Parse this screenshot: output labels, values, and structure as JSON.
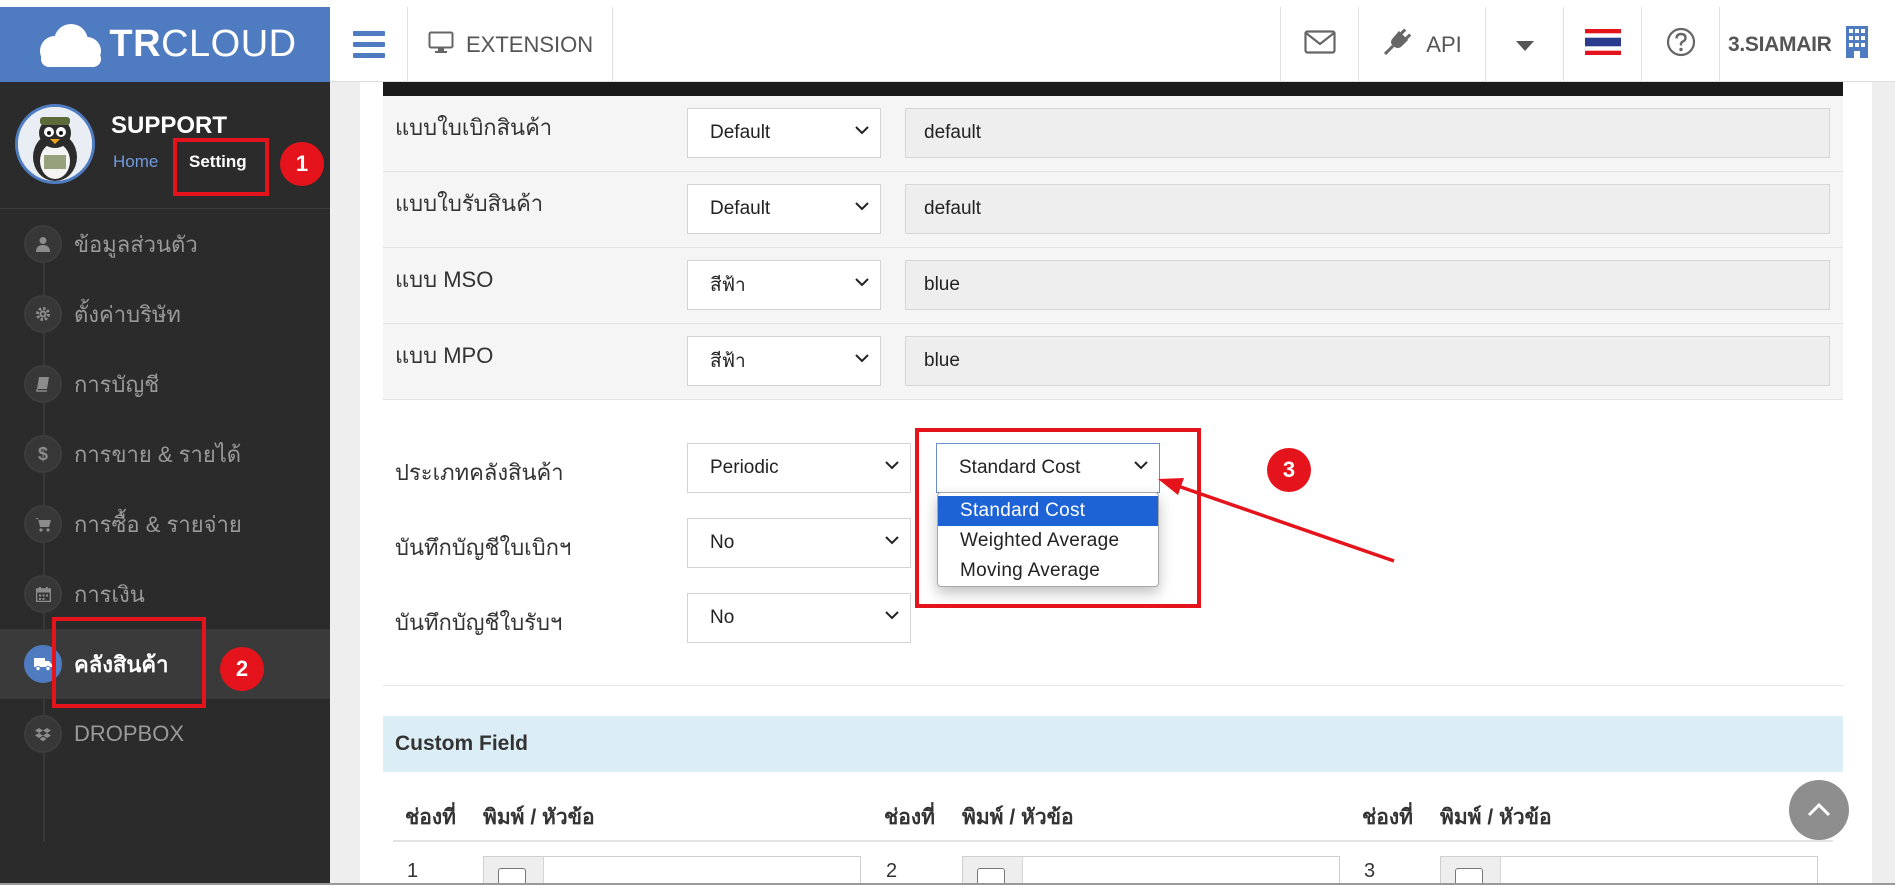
{
  "topbar": {
    "brand_bold": "TR",
    "brand_light": "CLOUD",
    "extension_label": "EXTENSION",
    "api_label": "API",
    "username": "3.SIAMAIR"
  },
  "sidebar": {
    "profile_name": "SUPPORT",
    "link_home": "Home",
    "link_setting": "Setting",
    "items": [
      {
        "label": "ข้อมูลส่วนตัว",
        "icon": "user-icon"
      },
      {
        "label": "ตั้งค่าบริษัท",
        "icon": "gear-icon"
      },
      {
        "label": "การบัญชี",
        "icon": "book-icon"
      },
      {
        "label": "การขาย & รายได้",
        "icon": "dollar-icon"
      },
      {
        "label": "การซื้อ & รายจ่าย",
        "icon": "cart-icon"
      },
      {
        "label": "การเงิน",
        "icon": "calendar-icon"
      },
      {
        "label": "คลังสินค้า",
        "icon": "truck-icon",
        "active": true
      },
      {
        "label": "DROPBOX",
        "icon": "dropbox-icon"
      }
    ]
  },
  "form": {
    "rows": [
      {
        "label": "แบบใบเบิกสินค้า",
        "select": "Default",
        "value": "default"
      },
      {
        "label": "แบบใบรับสินค้า",
        "select": "Default",
        "value": "default"
      },
      {
        "label": "แบบ MSO",
        "select": "สีฟ้า",
        "value": "blue"
      },
      {
        "label": "แบบ MPO",
        "select": "สีฟ้า",
        "value": "blue"
      }
    ],
    "inventory_type_label": "ประเภทคลังสินค้า",
    "inventory_type_value": "Periodic",
    "cost_method_value": "Standard Cost",
    "cost_method_options": [
      "Standard Cost",
      "Weighted Average",
      "Moving Average"
    ],
    "withdraw_record_label": "บันทึกบัญชีใบเบิกฯ",
    "withdraw_record_value": "No",
    "receive_record_label": "บันทึกบัญชีใบรับฯ",
    "receive_record_value": "No"
  },
  "custom_field": {
    "title": "Custom Field",
    "col_slot": "ช่องที่",
    "col_type": "พิมพ์ / หัวข้อ",
    "first_row_numbers": [
      "1",
      "2",
      "3"
    ]
  },
  "annotations": [
    "1",
    "2",
    "3"
  ],
  "colors": {
    "brand_blue": "#4f7cc0",
    "sidebar_bg": "#2b2b2b",
    "annotation_red": "#e5141c",
    "dropdown_highlight": "#1e63d6",
    "custom_field_bg": "#dbeef6"
  }
}
